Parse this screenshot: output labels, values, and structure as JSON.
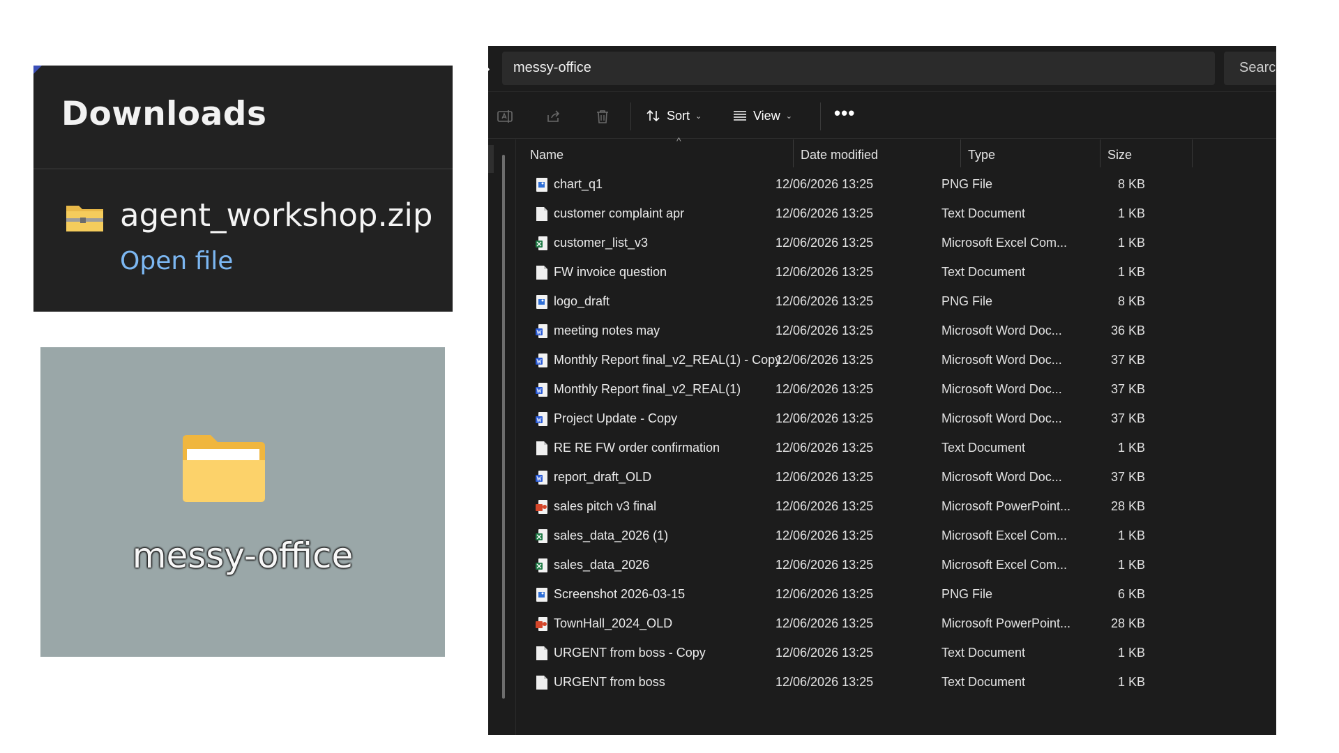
{
  "downloads": {
    "title": "Downloads",
    "file_name": "agent_workshop.zip",
    "open_label": "Open file"
  },
  "desktop": {
    "folder_label": "messy-office"
  },
  "explorer": {
    "address": "messy-office",
    "search_placeholder": "Search",
    "toolbar": {
      "sort_label": "Sort",
      "view_label": "View",
      "more_label": "•••"
    },
    "columns": {
      "name": "Name",
      "date": "Date modified",
      "type": "Type",
      "size": "Size"
    },
    "files": [
      {
        "name": "chart_q1",
        "date": "12/06/2026 13:25",
        "type": "PNG File",
        "size": "8 KB",
        "icon": "png"
      },
      {
        "name": "customer complaint apr",
        "date": "12/06/2026 13:25",
        "type": "Text Document",
        "size": "1 KB",
        "icon": "txt"
      },
      {
        "name": "customer_list_v3",
        "date": "12/06/2026 13:25",
        "type": "Microsoft Excel Com...",
        "size": "1 KB",
        "icon": "xls"
      },
      {
        "name": "FW invoice question",
        "date": "12/06/2026 13:25",
        "type": "Text Document",
        "size": "1 KB",
        "icon": "txt"
      },
      {
        "name": "logo_draft",
        "date": "12/06/2026 13:25",
        "type": "PNG File",
        "size": "8 KB",
        "icon": "png"
      },
      {
        "name": "meeting notes may",
        "date": "12/06/2026 13:25",
        "type": "Microsoft Word Doc...",
        "size": "36 KB",
        "icon": "doc"
      },
      {
        "name": "Monthly Report final_v2_REAL(1) - Copy",
        "date": "12/06/2026 13:25",
        "type": "Microsoft Word Doc...",
        "size": "37 KB",
        "icon": "doc"
      },
      {
        "name": "Monthly Report final_v2_REAL(1)",
        "date": "12/06/2026 13:25",
        "type": "Microsoft Word Doc...",
        "size": "37 KB",
        "icon": "doc"
      },
      {
        "name": "Project Update - Copy",
        "date": "12/06/2026 13:25",
        "type": "Microsoft Word Doc...",
        "size": "37 KB",
        "icon": "doc"
      },
      {
        "name": "RE RE FW order confirmation",
        "date": "12/06/2026 13:25",
        "type": "Text Document",
        "size": "1 KB",
        "icon": "txt"
      },
      {
        "name": "report_draft_OLD",
        "date": "12/06/2026 13:25",
        "type": "Microsoft Word Doc...",
        "size": "37 KB",
        "icon": "doc"
      },
      {
        "name": "sales pitch v3 final",
        "date": "12/06/2026 13:25",
        "type": "Microsoft PowerPoint...",
        "size": "28 KB",
        "icon": "ppt"
      },
      {
        "name": "sales_data_2026 (1)",
        "date": "12/06/2026 13:25",
        "type": "Microsoft Excel Com...",
        "size": "1 KB",
        "icon": "xls"
      },
      {
        "name": "sales_data_2026",
        "date": "12/06/2026 13:25",
        "type": "Microsoft Excel Com...",
        "size": "1 KB",
        "icon": "xls"
      },
      {
        "name": "Screenshot 2026-03-15",
        "date": "12/06/2026 13:25",
        "type": "PNG File",
        "size": "6 KB",
        "icon": "png"
      },
      {
        "name": "TownHall_2024_OLD",
        "date": "12/06/2026 13:25",
        "type": "Microsoft PowerPoint...",
        "size": "28 KB",
        "icon": "ppt"
      },
      {
        "name": "URGENT from boss - Copy",
        "date": "12/06/2026 13:25",
        "type": "Text Document",
        "size": "1 KB",
        "icon": "txt"
      },
      {
        "name": "URGENT from boss",
        "date": "12/06/2026 13:25",
        "type": "Text Document",
        "size": "1 KB",
        "icon": "txt"
      }
    ]
  }
}
